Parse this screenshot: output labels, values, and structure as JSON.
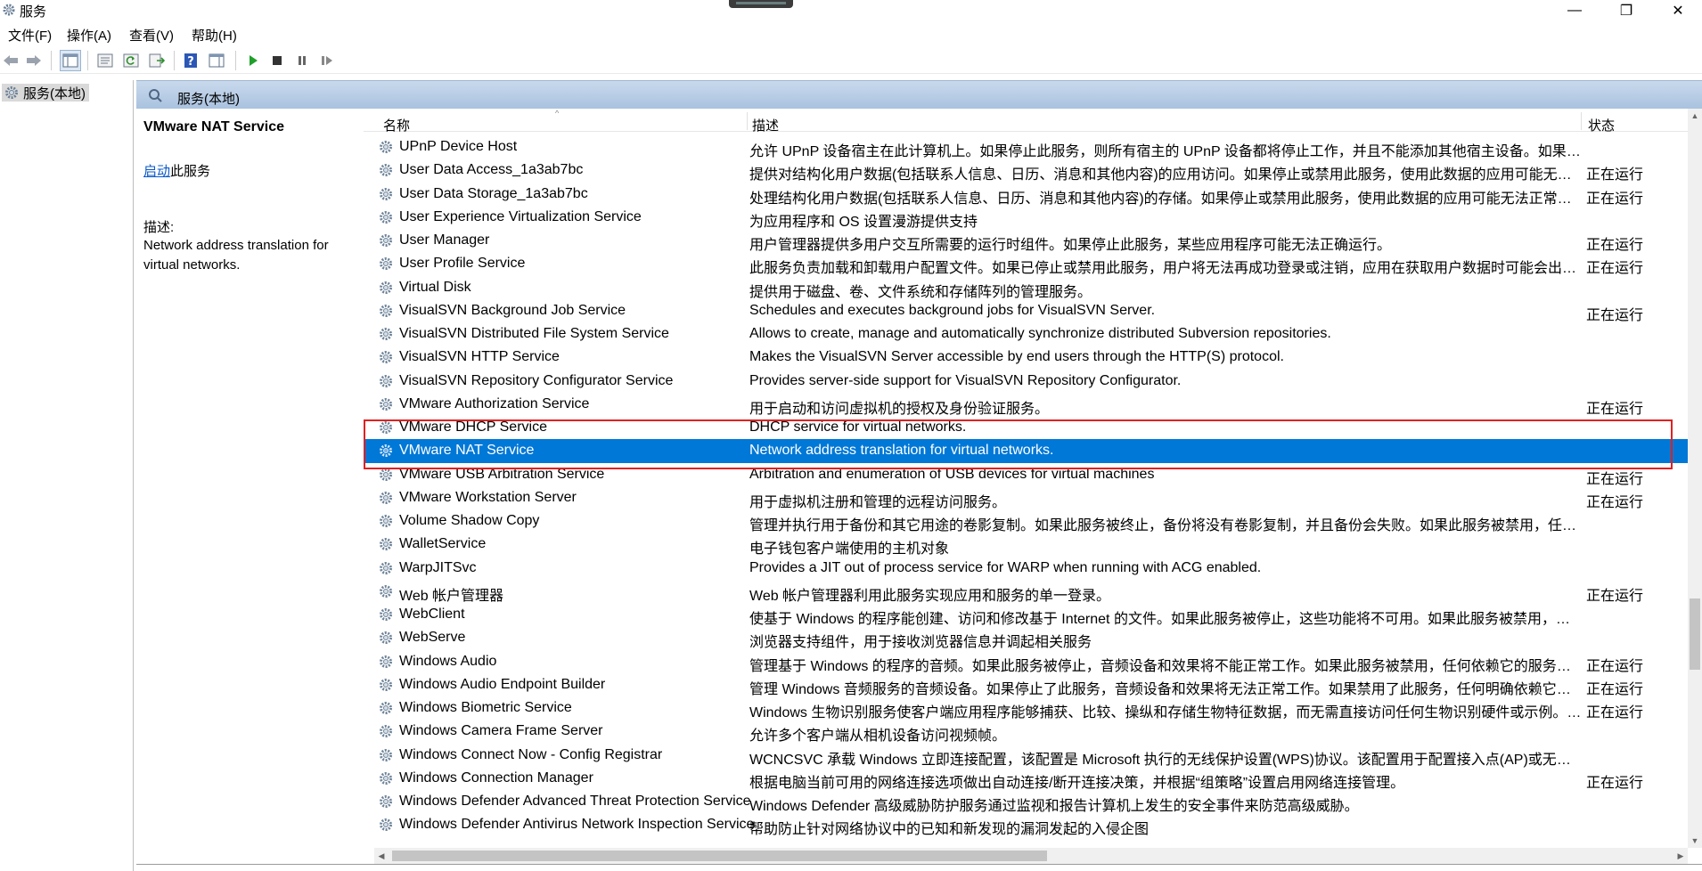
{
  "window": {
    "title": "服务",
    "icon": "gear-icon",
    "controls": {
      "minimize": "—",
      "maximize": "❐",
      "close": "✕"
    }
  },
  "menu": [
    "文件(F)",
    "操作(A)",
    "查看(V)",
    "帮助(H)"
  ],
  "toolbar": {
    "icons": [
      "back-arrow-icon",
      "forward-arrow-icon",
      "show-console-tree-icon",
      "properties-icon",
      "refresh-icon",
      "export-list-icon",
      "help-icon",
      "action-pane-icon",
      "start-service-icon",
      "stop-service-icon",
      "pause-service-icon",
      "restart-service-icon"
    ]
  },
  "tree": {
    "root_label": "服务(本地)"
  },
  "header": {
    "title": "服务(本地)"
  },
  "details": {
    "service_name": "VMware NAT Service",
    "action_link": "启动",
    "action_suffix": "此服务",
    "description_label": "描述:",
    "description": "Network address translation for virtual networks."
  },
  "columns": {
    "name": "名称",
    "description": "描述",
    "status": "状态"
  },
  "rows": [
    {
      "name": "UPnP Device Host",
      "description": "允许 UPnP 设备宿主在此计算机上。如果停止此服务，则所有宿主的 UPnP 设备都将停止工作，并且不能添加其他宿主设备。如果禁用此服务，则任何显式依赖它的服务都将无法启动。",
      "status": ""
    },
    {
      "name": "User Data Access_1a3ab7bc",
      "description": "提供对结构化用户数据(包括联系人信息、日历、消息和其他内容)的应用访问。如果停止或禁用此服务，使用此数据的应用可能无法正常工作。",
      "status": "正在运行"
    },
    {
      "name": "User Data Storage_1a3ab7bc",
      "description": "处理结构化用户数据(包括联系人信息、日历、消息和其他内容)的存储。如果停止或禁用此服务，使用此数据的应用可能无法正常工作。",
      "status": "正在运行"
    },
    {
      "name": "User Experience Virtualization Service",
      "description": "为应用程序和 OS 设置漫游提供支持",
      "status": ""
    },
    {
      "name": "User Manager",
      "description": "用户管理器提供多用户交互所需要的运行时组件。如果停止此服务，某些应用程序可能无法正确运行。",
      "status": "正在运行"
    },
    {
      "name": "User Profile Service",
      "description": "此服务负责加载和卸载用户配置文件。如果已停止或禁用此服务，用户将无法再成功登录或注销，应用在获取用户数据时可能会出问题，而且注册以接收用户配置文件事件通知的组件将无法接收这些通知。",
      "status": "正在运行"
    },
    {
      "name": "Virtual Disk",
      "description": "提供用于磁盘、卷、文件系统和存储阵列的管理服务。",
      "status": ""
    },
    {
      "name": "VisualSVN Background Job Service",
      "description": "Schedules and executes background jobs for VisualSVN Server.",
      "status": "正在运行"
    },
    {
      "name": "VisualSVN Distributed File System Service",
      "description": "Allows to create, manage and automatically synchronize distributed Subversion repositories.",
      "status": ""
    },
    {
      "name": "VisualSVN HTTP Service",
      "description": "Makes the VisualSVN Server accessible by end users through the HTTP(S) protocol.",
      "status": ""
    },
    {
      "name": "VisualSVN Repository Configurator Service",
      "description": "Provides server-side support for VisualSVN Repository Configurator.",
      "status": ""
    },
    {
      "name": "VMware Authorization Service",
      "description": "用于启动和访问虚拟机的授权及身份验证服务。",
      "status": "正在运行"
    },
    {
      "name": "VMware DHCP Service",
      "description": "DHCP service for virtual networks.",
      "status": ""
    },
    {
      "name": "VMware NAT Service",
      "description": "Network address translation for virtual networks.",
      "status": "",
      "selected": true
    },
    {
      "name": "VMware USB Arbitration Service",
      "description": "Arbitration and enumeration of USB devices for virtual machines",
      "status": "正在运行"
    },
    {
      "name": "VMware Workstation Server",
      "description": "用于虚拟机注册和管理的远程访问服务。",
      "status": "正在运行"
    },
    {
      "name": "Volume Shadow Copy",
      "description": "管理并执行用于备份和其它用途的卷影复制。如果此服务被终止，备份将没有卷影复制，并且备份会失败。如果此服务被禁用，任何依赖它的服务都将无法启动。",
      "status": ""
    },
    {
      "name": "WalletService",
      "description": "电子钱包客户端使用的主机对象",
      "status": ""
    },
    {
      "name": "WarpJITSvc",
      "description": "Provides a JIT out of process service for WARP when running with ACG enabled.",
      "status": ""
    },
    {
      "name": "Web 帐户管理器",
      "description": "Web 帐户管理器利用此服务实现应用和服务的单一登录。",
      "status": "正在运行"
    },
    {
      "name": "WebClient",
      "description": "使基于 Windows 的程序能创建、访问和修改基于 Internet 的文件。如果此服务被停止，这些功能将不可用。如果此服务被禁用，则明确依赖它的所有服务都将无法启动。",
      "status": ""
    },
    {
      "name": "WebServe",
      "description": "浏览器支持组件，用于接收浏览器信息并调起相关服务",
      "status": ""
    },
    {
      "name": "Windows Audio",
      "description": "管理基于 Windows 的程序的音频。如果此服务被停止，音频设备和效果将不能正常工作。如果此服务被禁用，任何依赖它的服务都将无法启动",
      "status": "正在运行"
    },
    {
      "name": "Windows Audio Endpoint Builder",
      "description": "管理 Windows 音频服务的音频设备。如果停止了此服务，音频设备和效果将无法正常工作。如果禁用了此服务，任何明确依赖它的服务都将无法启动",
      "status": "正在运行"
    },
    {
      "name": "Windows Biometric Service",
      "description": "Windows 生物识别服务使客户端应用程序能够捕获、比较、操纵和存储生物特征数据，而无需直接访问任何生物识别硬件或示例。该服务托管在特权 SVCHOST 进程中。",
      "status": "正在运行"
    },
    {
      "name": "Windows Camera Frame Server",
      "description": "允许多个客户端从相机设备访问视频帧。",
      "status": ""
    },
    {
      "name": "Windows Connect Now - Config Registrar",
      "description": "WCNCSVC 承载 Windows 立即连接配置，该配置是 Microsoft 执行的无线保护设置(WPS)协议。该配置用于配置接入点(AP)或无线设备的无线 LAN 设置。",
      "status": ""
    },
    {
      "name": "Windows Connection Manager",
      "description": "根据电脑当前可用的网络连接选项做出自动连接/断开连接决策，并根据“组策略”设置启用网络连接管理。",
      "status": "正在运行"
    },
    {
      "name": "Windows Defender Advanced Threat Protection Service",
      "description": "Windows Defender 高级威胁防护服务通过监视和报告计算机上发生的安全事件来防范高级威胁。",
      "status": ""
    },
    {
      "name": "Windows Defender Antivirus Network Inspection Service",
      "description": "帮助防止针对网络协议中的已知和新发现的漏洞发起的入侵企图",
      "status": ""
    }
  ]
}
